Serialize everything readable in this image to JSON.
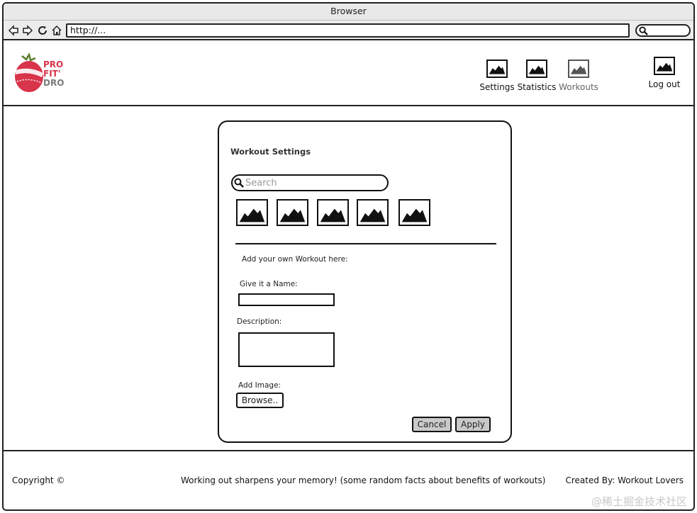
{
  "browser": {
    "title": "Browser",
    "url": "http://..."
  },
  "logo": {
    "lines": [
      "PRO",
      "FIT'",
      "DRO"
    ],
    "colors": {
      "red": "#d8344a",
      "gray": "#7a7a7a"
    }
  },
  "nav": {
    "settings": "Settings",
    "statistics": "Statistics",
    "workouts": "Workouts",
    "logout": "Log out"
  },
  "panel": {
    "title": "Workout Settings",
    "search_placeholder": "Search",
    "thumbnails": [
      "image-icon",
      "image-icon",
      "image-icon",
      "image-icon",
      "image-icon"
    ],
    "add_heading": "Add your own Workout here:",
    "name_label": "Give it a Name:",
    "description_label": "Description:",
    "image_label": "Add Image:",
    "browse_label": "Browse..",
    "cancel_label": "Cancel",
    "apply_label": "Apply"
  },
  "footer": {
    "copyright": "Copyright ©",
    "fact": "Working out sharpens your memory! (some random facts about benefits of workouts)",
    "created_by": "Created By: Workout Lovers"
  },
  "watermark": "@稀土掘金技术社区"
}
